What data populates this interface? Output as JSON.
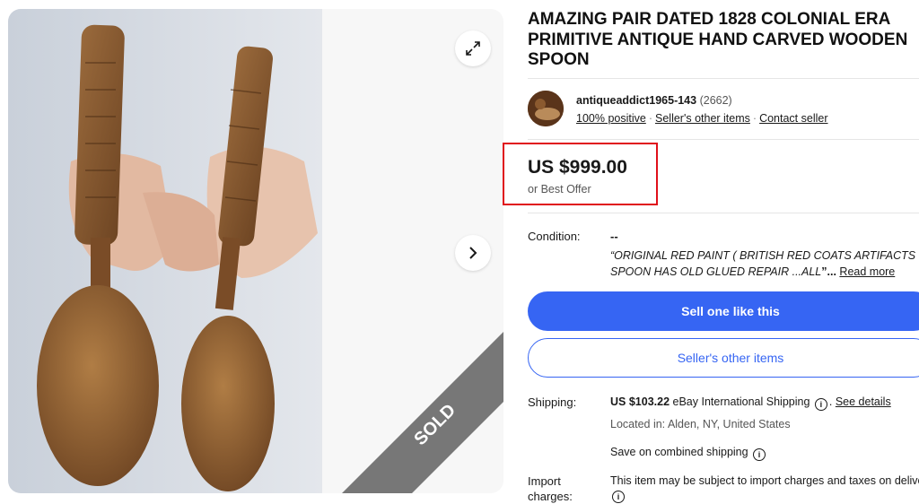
{
  "gallery": {
    "sold_label": "SOLD",
    "expand_icon": "expand-icon",
    "next_icon": "chevron-right-icon"
  },
  "listing": {
    "title": "AMAZING PAIR DATED 1828 COLONIAL ERA PRIMITIVE ANTIQUE HAND CARVED WOODEN SPOON"
  },
  "seller": {
    "name": "antiqueaddict1965-143",
    "feedback_count": "(2662)",
    "positive": "100% positive",
    "other_items": "Seller's other items",
    "contact": "Contact seller"
  },
  "price": {
    "amount": "US $999.00",
    "best_offer": "or Best Offer"
  },
  "condition": {
    "label": "Condition:",
    "value": "--",
    "desc_line1": "“ORIGINAL RED PAINT ( BRITISH RED COATS ARTIFACTS ?? )",
    "desc_line2": "SPOON HAS OLD GLUED REPAIR ...ALL",
    "desc_end": "”...",
    "read_more": "Read more"
  },
  "buttons": {
    "sell_one": "Sell one like this",
    "seller_other_items": "Seller's other items"
  },
  "shipping": {
    "label": "Shipping:",
    "cost": "US $103.22",
    "method": "eBay International Shipping",
    "see_details": "See details",
    "located": "Located in: Alden, NY, United States",
    "combined": "Save on combined shipping"
  },
  "import": {
    "label_line1": "Import",
    "label_line2": "charges:",
    "text": "This item may be subject to import charges and taxes on delivery"
  },
  "colors": {
    "accent": "#3665f3",
    "highlight": "#e0101a",
    "sold_ribbon": "#777777"
  }
}
